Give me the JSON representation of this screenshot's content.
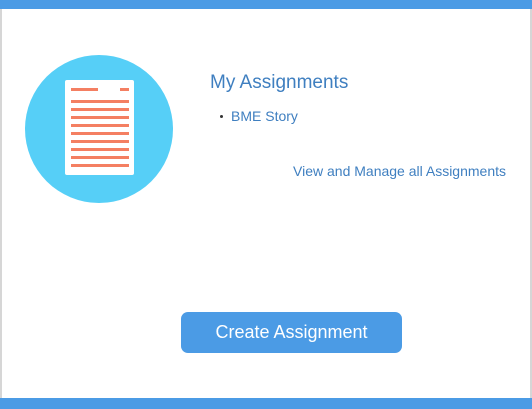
{
  "assignments": {
    "title": "My Assignments",
    "items": [
      {
        "label": "BME Story"
      }
    ],
    "view_all_label": "View and Manage all Assignments",
    "create_label": "Create Assignment"
  },
  "colors": {
    "accent": "#4b9be5",
    "link": "#3f7fc0",
    "circle": "#56cff7",
    "doc_lines": "#f47f62"
  },
  "icons": {
    "document": "document-icon"
  }
}
